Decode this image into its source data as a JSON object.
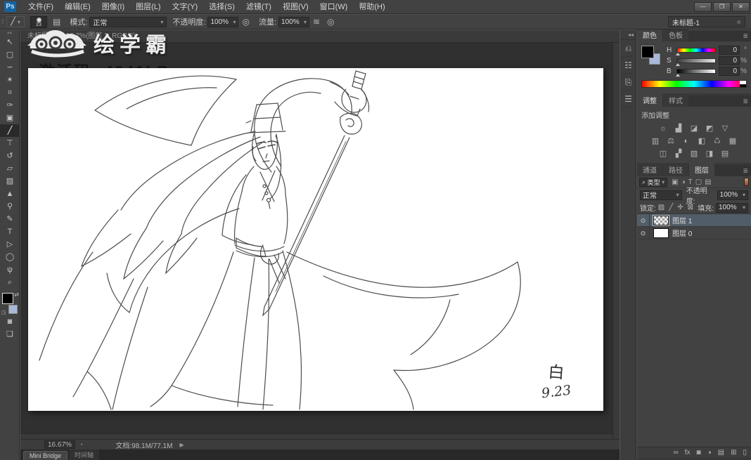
{
  "window": {
    "minimize": "—",
    "maximize": "❐",
    "close": "✕",
    "doc_selector": "未标题-1",
    "doc_selector_caret": "≑"
  },
  "menubar": {
    "logo_text": "Ps",
    "items": [
      "文件(F)",
      "编辑(E)",
      "图像(I)",
      "图层(L)",
      "文字(Y)",
      "选择(S)",
      "滤镜(T)",
      "视图(V)",
      "窗口(W)",
      "帮助(H)"
    ]
  },
  "options": {
    "tool_glyph": "╱",
    "tool_caret": "▾",
    "brush_size": "23",
    "panel_toggle_glyph": "▤",
    "mode_label": "模式:",
    "mode_value": "正常",
    "opacity_label": "不透明度:",
    "opacity_value": "100%",
    "pressure_glyph": "◎",
    "flow_label": "流量:",
    "flow_value": "100%",
    "airbrush_glyph": "≋",
    "caret": "▾",
    "grip": "⁞⁞"
  },
  "tools": [
    {
      "name": "move-tool",
      "glyph": "↖"
    },
    {
      "name": "rectangular-marquee-tool",
      "glyph": "▢"
    },
    {
      "name": "lasso-tool",
      "glyph": "∽"
    },
    {
      "name": "magic-wand-tool",
      "glyph": "✶"
    },
    {
      "name": "crop-tool",
      "glyph": "⌗"
    },
    {
      "name": "eyedropper-tool",
      "glyph": "✑"
    },
    {
      "name": "spot-healing-brush-tool",
      "glyph": "▣"
    },
    {
      "name": "brush-tool",
      "glyph": "╱"
    },
    {
      "name": "clone-stamp-tool",
      "glyph": "⊤"
    },
    {
      "name": "history-brush-tool",
      "glyph": "↺"
    },
    {
      "name": "eraser-tool",
      "glyph": "▱"
    },
    {
      "name": "gradient-tool",
      "glyph": "▨"
    },
    {
      "name": "blur-tool",
      "glyph": "▲"
    },
    {
      "name": "dodge-tool",
      "glyph": "⚲"
    },
    {
      "name": "pen-tool",
      "glyph": "✎"
    },
    {
      "name": "type-tool",
      "glyph": "T"
    },
    {
      "name": "path-selection-tool",
      "glyph": "▷"
    },
    {
      "name": "ellipse-tool",
      "glyph": "◯"
    },
    {
      "name": "hand-tool",
      "glyph": "ψ"
    },
    {
      "name": "zoom-tool",
      "glyph": "⌕"
    }
  ],
  "toolbar_extra": {
    "quick_mask_glyph": "◙",
    "screen_mode_glyph": "❏",
    "swap_glyph": "⇄",
    "mini_swatch_glyph": "◳"
  },
  "dock": {
    "collapse_glyph": "◂◂",
    "icons": [
      {
        "name": "history-panel",
        "glyph": "⎌"
      },
      {
        "name": "brush-settings-panel",
        "glyph": "☷"
      },
      {
        "name": "clone-source-panel",
        "glyph": "⎘"
      },
      {
        "name": "properties-panel",
        "glyph": "☰"
      }
    ]
  },
  "color_panel": {
    "tab_color": "颜色",
    "tab_swatches": "色板",
    "menu_glyph": "≣",
    "h_label": "H",
    "h_value": "0",
    "h_unit": "°",
    "s_label": "S",
    "s_value": "0",
    "s_unit": "%",
    "b_label": "B",
    "b_value": "0",
    "b_unit": "%"
  },
  "adjust_panel": {
    "tab_adjust": "调整",
    "tab_styles": "样式",
    "menu_glyph": "≣",
    "add_label": "添加调整",
    "row1": [
      "☼",
      "▟",
      "◪",
      "◩",
      "▽"
    ],
    "row2": [
      "▥",
      "⚖",
      "◐",
      "◧",
      "♺",
      "▦"
    ],
    "row3": [
      "◫",
      "▞",
      "▧",
      "◨",
      "▤"
    ]
  },
  "layers_panel": {
    "tab_channels": "通道",
    "tab_paths": "路径",
    "tab_layers": "图层",
    "menu_glyph": "≣",
    "search_glyph": "⌕",
    "filter_label": "类型",
    "filter_caret": "▾",
    "filter_icons": [
      "▣",
      "◑",
      "T",
      "▢",
      "▤"
    ],
    "blend_value": "正常",
    "blend_caret": "▾",
    "opacity_label": "不透明度:",
    "opacity_value": "100%",
    "lock_label": "锁定:",
    "lock_icons": [
      "▨",
      "╱",
      "✛",
      "⊠"
    ],
    "fill_label": "填充:",
    "fill_value": "100%",
    "caret": "▾",
    "eye_glyph": "⊙",
    "layers": [
      {
        "name": "图层 1"
      },
      {
        "name": "图层 0"
      }
    ],
    "foot_icons": [
      {
        "name": "link-layers",
        "glyph": "∞"
      },
      {
        "name": "layer-style-fx",
        "glyph": "fx"
      },
      {
        "name": "add-layer-mask",
        "glyph": "◙"
      },
      {
        "name": "new-adjustment-layer",
        "glyph": "◑"
      },
      {
        "name": "new-group",
        "glyph": "▤"
      },
      {
        "name": "new-layer",
        "glyph": "⊞"
      },
      {
        "name": "delete-layer",
        "glyph": "▯"
      }
    ]
  },
  "document": {
    "tab_title": "未标题-1 @ 16.7%(图层 1, RGB/8)",
    "watermark_title": "绘学霸",
    "watermark_line2": "激活码: 4041LB",
    "signature_char": "白",
    "signature_date": "9.23"
  },
  "status": {
    "zoom": "16.67%",
    "zoom_icon_glyph": "◔",
    "doc_info": "文档:98.1M/77.1M",
    "arrow_glyph": "▶",
    "tab_minibridge": "Mini Bridge",
    "tab_timeline": "时间轴"
  },
  "colors": {
    "foreground": "#000000",
    "background": "#a9b8d8",
    "selection": "#515d68",
    "accent_logo": "#15639e"
  }
}
